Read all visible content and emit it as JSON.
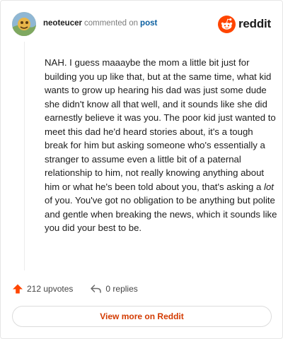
{
  "header": {
    "username": "neoteucer",
    "action_text": "commented on",
    "post_link": "post",
    "brand_word": "reddit"
  },
  "comment": {
    "text_before": "NAH. I guess maaaybe the mom a little bit just for building you up like that, but at the same time, what kid wants to grow up hearing his dad was just some dude she didn't know all that well, and it sounds like she did earnestly believe it was you. The poor kid just wanted to meet this dad he'd heard stories about, it's a tough break for him but asking someone who's essentially a stranger to assume even a little bit of a paternal relationship to him, not really knowing anything about him or what he's been told about you, that's asking a",
    "emphasis": "lot",
    "text_after": "of you. You've got no obligation to be anything but polite and gentle when breaking the news, which it sounds like you did your best to be."
  },
  "actions": {
    "upvotes": "212 upvotes",
    "replies": "0 replies"
  },
  "footer": {
    "view_more_label": "View more on Reddit"
  },
  "colors": {
    "brand_orange": "#ff4500",
    "link_blue": "#0a5fa0",
    "cta_text": "#d33a00"
  },
  "icons": {
    "avatar": "avatar-icon",
    "brand": "reddit-logo-icon",
    "upvote": "upvote-arrow-icon",
    "reply": "reply-arrow-icon"
  }
}
